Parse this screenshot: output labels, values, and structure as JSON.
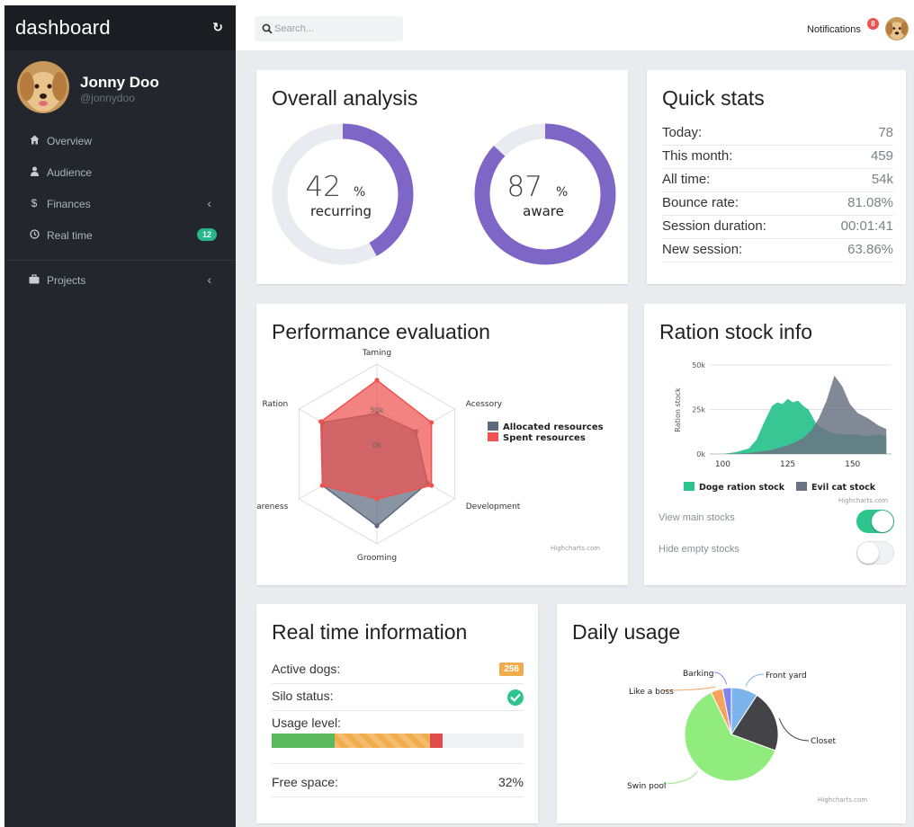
{
  "app": {
    "title": "dashboard"
  },
  "user": {
    "name": "Jonny Doo",
    "handle": "@jonnydoo"
  },
  "nav": [
    {
      "label": "Overview",
      "icon": "home-icon"
    },
    {
      "label": "Audience",
      "icon": "user-icon"
    },
    {
      "label": "Finances",
      "icon": "dollar-icon"
    },
    {
      "label": "Real time",
      "icon": "clock-icon",
      "badge": "12"
    },
    {
      "label": "Projects",
      "icon": "briefcase-icon"
    }
  ],
  "search": {
    "placeholder": "Search..."
  },
  "notifications": {
    "label": "Notifications",
    "count": "8"
  },
  "overall": {
    "title": "Overall analysis",
    "donuts": [
      {
        "value": "42",
        "unit": "%",
        "label": "recurring",
        "fraction": 0.42
      },
      {
        "value": "87",
        "unit": "%",
        "label": "aware",
        "fraction": 0.87
      }
    ],
    "colors": {
      "fill": "#7e66c6",
      "track": "#e8ebef"
    }
  },
  "quick": {
    "title": "Quick stats",
    "rows": [
      {
        "k": "Today:",
        "v": "78"
      },
      {
        "k": "This month:",
        "v": "459"
      },
      {
        "k": "All time:",
        "v": "54k"
      },
      {
        "k": "Bounce rate:",
        "v": "81.08%"
      },
      {
        "k": "Session duration:",
        "v": "00:01:41"
      },
      {
        "k": "New session:",
        "v": "63.86%"
      }
    ]
  },
  "performance": {
    "title": "Performance evaluation",
    "credit": "Highcharts.com"
  },
  "ration": {
    "title": "Ration stock info",
    "credit": "Highcharts.com",
    "toggles": [
      {
        "label": "View main stocks",
        "on": true
      },
      {
        "label": "Hide empty stocks",
        "on": false
      }
    ]
  },
  "realtime": {
    "title": "Real time information",
    "active_label": "Active dogs:",
    "active_value": "256",
    "silo_label": "Silo status:",
    "usage_label": "Usage level:",
    "usage": [
      {
        "fraction": 0.25,
        "color": "#5cb85c"
      },
      {
        "fraction": 0.38,
        "color": "#f0ad4e"
      },
      {
        "fraction": 0.05,
        "color": "#e04b4b"
      }
    ],
    "free_label": "Free space:",
    "free_value": "32%"
  },
  "daily": {
    "title": "Daily usage",
    "credit": "Highcharts.com"
  },
  "chart_data": [
    {
      "type": "radar",
      "title": "",
      "axes": [
        "Taming",
        "Acessory",
        "Development",
        "Grooming",
        "Awareness",
        "Ration"
      ],
      "radial_labels": [
        "0k",
        "50k"
      ],
      "ylim": [
        0,
        100000
      ],
      "legend": "right",
      "series": [
        {
          "name": "Allocated resources",
          "color": "#5d6b7e",
          "values": [
            45000,
            50000,
            65000,
            80000,
            70000,
            70000
          ]
        },
        {
          "name": "Spent resources",
          "color": "#ef5350",
          "values": [
            82000,
            70000,
            70000,
            50000,
            70000,
            72000
          ]
        }
      ]
    },
    {
      "type": "area",
      "title": "",
      "xlabel": "",
      "ylabel": "Ration stock",
      "xlim": [
        95,
        165
      ],
      "ylim": [
        0,
        50000
      ],
      "x_ticks": [
        "100",
        "125",
        "150"
      ],
      "y_ticks": [
        "0k",
        "25k",
        "50k"
      ],
      "legend": "bottom",
      "series": [
        {
          "name": "Doge ration stock",
          "color": "#2dc48e",
          "x": [
            100,
            105,
            110,
            113,
            116,
            119,
            121,
            123,
            125,
            127,
            129,
            131,
            133,
            136,
            139,
            142,
            145,
            148,
            151,
            155,
            160,
            163
          ],
          "values": [
            0,
            1000,
            3000,
            8000,
            18000,
            27000,
            29000,
            28000,
            31000,
            29000,
            30000,
            27000,
            25000,
            17000,
            14000,
            12000,
            11000,
            11000,
            11000,
            10000,
            11000,
            10000
          ]
        },
        {
          "name": "Evil cat stock",
          "color": "#6b7384",
          "x": [
            100,
            110,
            118,
            123,
            127,
            131,
            134,
            137,
            140,
            143,
            146,
            149,
            152,
            156,
            160,
            163
          ],
          "values": [
            0,
            500,
            2000,
            4000,
            6000,
            9000,
            13000,
            20000,
            30000,
            44000,
            38000,
            28000,
            23000,
            20000,
            16000,
            14000
          ]
        }
      ]
    },
    {
      "type": "pie",
      "title": "",
      "slices": [
        {
          "label": "Front yard",
          "value": 9,
          "color": "#7cb5ec"
        },
        {
          "label": "Closet",
          "value": 21,
          "color": "#434348"
        },
        {
          "label": "Swin pool",
          "value": 61,
          "color": "#90ed7d"
        },
        {
          "label": "Like a boss",
          "value": 4,
          "color": "#f7a35c"
        },
        {
          "label": "Barking",
          "value": 3,
          "color": "#8085e9"
        }
      ]
    }
  ]
}
